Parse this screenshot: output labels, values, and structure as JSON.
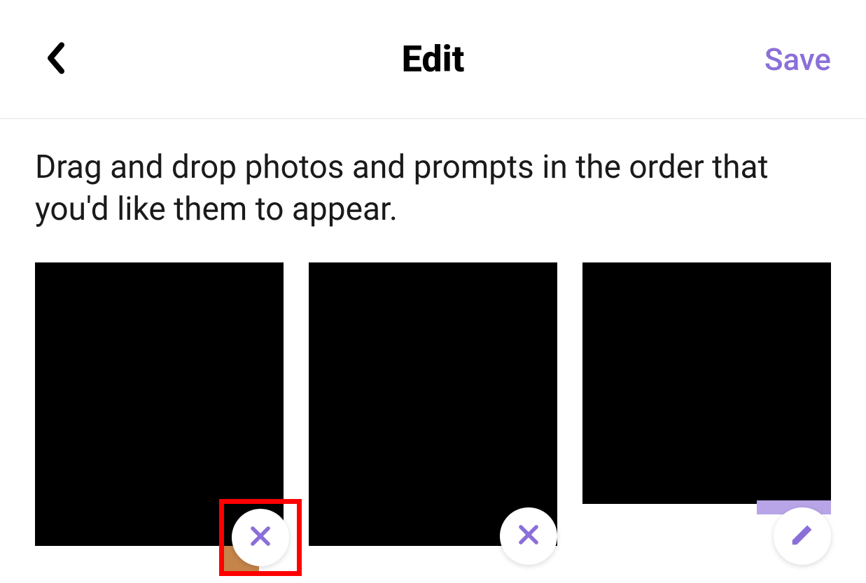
{
  "header": {
    "title": "Edit",
    "save_label": "Save"
  },
  "instructions": "Drag and drop photos and prompts in the order that you'd like them to appear.",
  "photos": [
    {
      "action": "delete",
      "highlighted": true
    },
    {
      "action": "delete",
      "highlighted": false
    },
    {
      "action": "edit",
      "highlighted": false
    }
  ],
  "colors": {
    "accent": "#8b6fd9",
    "highlight": "#ff0000"
  }
}
